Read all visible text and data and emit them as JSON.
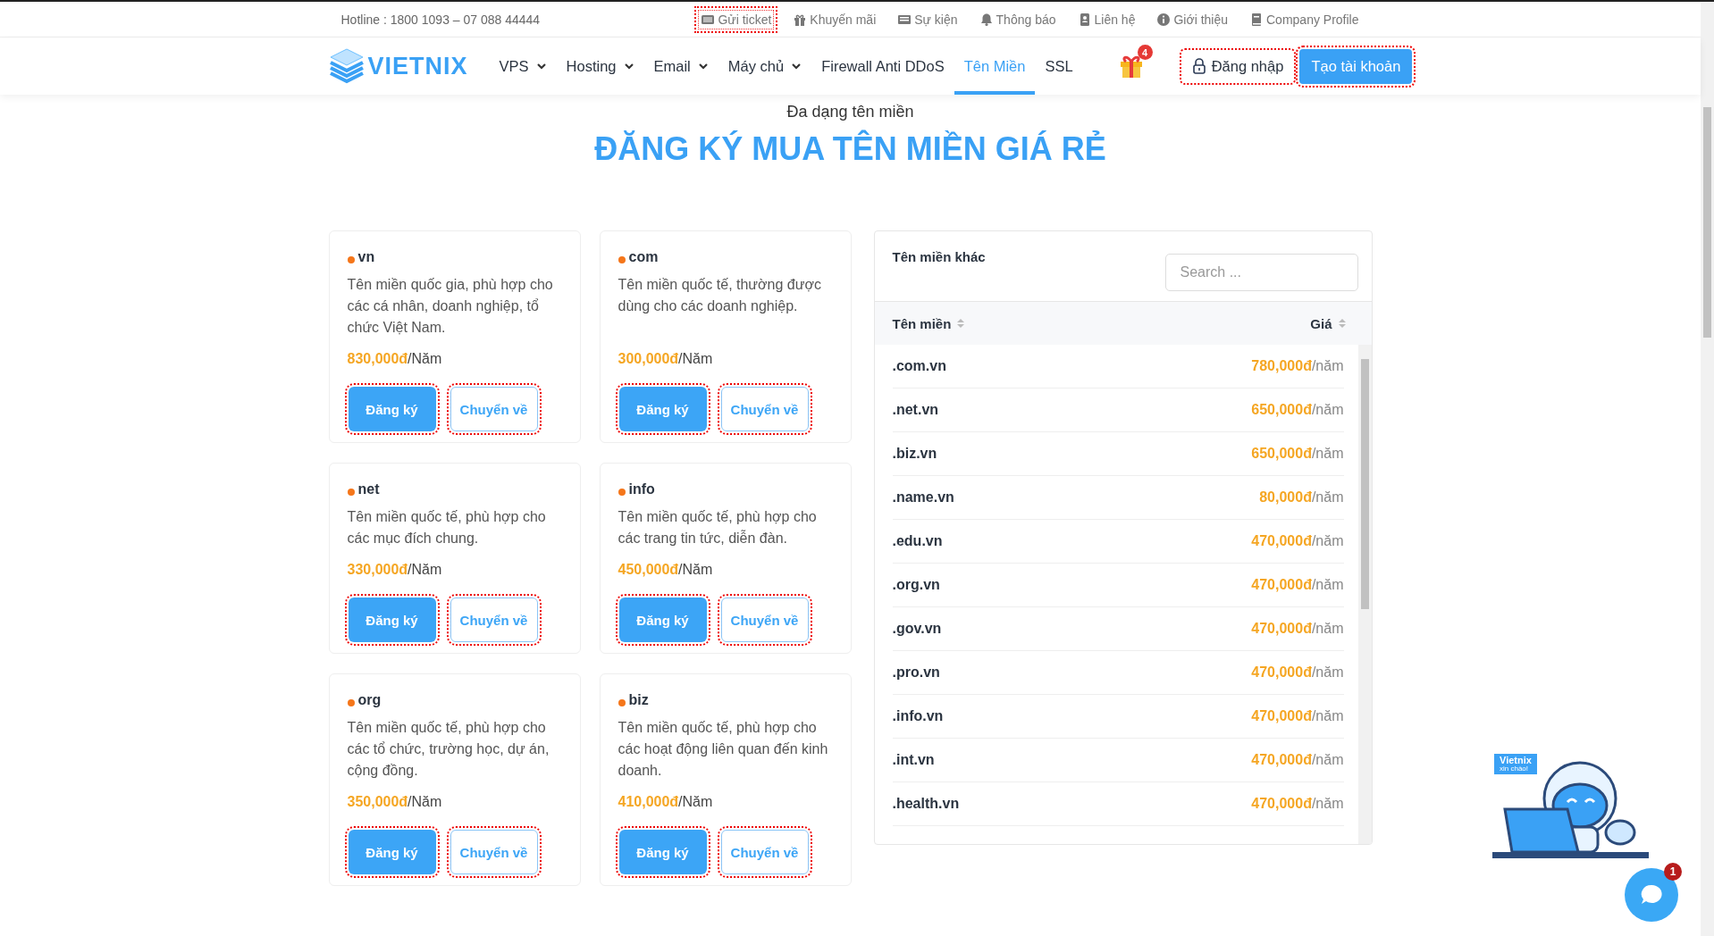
{
  "topbar": {
    "hotline": "Hotline : 1800 1093 – 07 088 44444",
    "links": [
      {
        "label": "Gửi ticket",
        "outlined": true
      },
      {
        "label": "Khuyến mãi",
        "outlined": false
      },
      {
        "label": "Sự kiện",
        "outlined": false
      },
      {
        "label": "Thông báo",
        "outlined": false
      },
      {
        "label": "Liên hệ",
        "outlined": false
      },
      {
        "label": "Giới thiệu",
        "outlined": false
      },
      {
        "label": "Company Profile",
        "outlined": false
      }
    ]
  },
  "nav": {
    "logo": "VIETNIX",
    "items": [
      {
        "label": "VPS",
        "dropdown": true,
        "selected": false
      },
      {
        "label": "Hosting",
        "dropdown": true,
        "selected": false
      },
      {
        "label": "Email",
        "dropdown": true,
        "selected": false
      },
      {
        "label": "Máy chủ",
        "dropdown": true,
        "selected": false
      },
      {
        "label": "Firewall Anti DDoS",
        "dropdown": false,
        "selected": false
      },
      {
        "label": "Tên Miền",
        "dropdown": false,
        "selected": true
      },
      {
        "label": "SSL",
        "dropdown": false,
        "selected": false
      }
    ],
    "gift_badge": "4",
    "login": {
      "label": "Đăng nhập",
      "outlined": true
    },
    "register": {
      "label": "Tạo tài khoản",
      "outlined": true
    }
  },
  "section": {
    "subtitle": "Đa dạng tên miền",
    "title": "ĐĂNG KÝ MUA TÊN MIỀN GIÁ RẺ"
  },
  "cards": [
    {
      "name": "vn",
      "description": "Tên miền quốc gia, phù hợp cho các cá nhân, doanh nghiệp, tổ chức Việt Nam.",
      "price": "830,000đ",
      "unit": "/Năm",
      "buttons": [
        {
          "label": "Đăng ký",
          "kind": "primary",
          "outlined": true
        },
        {
          "label": "Chuyển về",
          "kind": "secondary",
          "outlined": true
        }
      ]
    },
    {
      "name": "com",
      "description": "Tên miền quốc tế, thường được dùng cho các doanh nghiệp.",
      "price": "300,000đ",
      "unit": "/Năm",
      "buttons": [
        {
          "label": "Đăng ký",
          "kind": "primary",
          "outlined": true
        },
        {
          "label": "Chuyển về",
          "kind": "secondary",
          "outlined": true
        }
      ]
    },
    {
      "name": "net",
      "description": "Tên miền quốc tế, phù hợp cho các mục đích chung.",
      "price": "330,000đ",
      "unit": "/Năm",
      "buttons": [
        {
          "label": "Đăng ký",
          "kind": "primary",
          "outlined": true
        },
        {
          "label": "Chuyển về",
          "kind": "secondary",
          "outlined": true
        }
      ]
    },
    {
      "name": "info",
      "description": "Tên miền quốc tế, phù hợp cho các trang tin tức, diễn đàn.",
      "price": "450,000đ",
      "unit": "/Năm",
      "buttons": [
        {
          "label": "Đăng ký",
          "kind": "primary",
          "outlined": true
        },
        {
          "label": "Chuyển về",
          "kind": "secondary",
          "outlined": true
        }
      ]
    },
    {
      "name": "org",
      "description": "Tên miền quốc tế, phù hợp cho các tổ chức, trường học, dự án, cộng đồng.",
      "price": "350,000đ",
      "unit": "/Năm",
      "buttons": [
        {
          "label": "Đăng ký",
          "kind": "primary",
          "outlined": true
        },
        {
          "label": "Chuyển về",
          "kind": "secondary",
          "outlined": true
        }
      ]
    },
    {
      "name": "biz",
      "description": "Tên miền quốc tế, phù hợp cho các hoạt động liên quan đến kinh doanh.",
      "price": "410,000đ",
      "unit": "/Năm",
      "buttons": [
        {
          "label": "Đăng ký",
          "kind": "primary",
          "outlined": true
        },
        {
          "label": "Chuyển về",
          "kind": "secondary",
          "outlined": true
        }
      ]
    }
  ],
  "panel": {
    "title": "Tên miền khác",
    "search": {
      "placeholder": "Search ..."
    },
    "columns": [
      {
        "label": "Tên miền"
      },
      {
        "label": "Giá"
      }
    ],
    "rows": [
      {
        "domain": ".com.vn",
        "price": "780,000đ",
        "unit": "/năm"
      },
      {
        "domain": ".net.vn",
        "price": "650,000đ",
        "unit": "/năm"
      },
      {
        "domain": ".biz.vn",
        "price": "650,000đ",
        "unit": "/năm"
      },
      {
        "domain": ".name.vn",
        "price": "80,000đ",
        "unit": "/năm"
      },
      {
        "domain": ".edu.vn",
        "price": "470,000đ",
        "unit": "/năm"
      },
      {
        "domain": ".org.vn",
        "price": "470,000đ",
        "unit": "/năm"
      },
      {
        "domain": ".gov.vn",
        "price": "470,000đ",
        "unit": "/năm"
      },
      {
        "domain": ".pro.vn",
        "price": "470,000đ",
        "unit": "/năm"
      },
      {
        "domain": ".info.vn",
        "price": "470,000đ",
        "unit": "/năm"
      },
      {
        "domain": ".int.vn",
        "price": "470,000đ",
        "unit": "/năm"
      },
      {
        "domain": ".health.vn",
        "price": "470,000đ",
        "unit": "/năm"
      }
    ]
  },
  "chat": {
    "bubble_title": "Vietnix",
    "bubble_text": "xin chào!",
    "badge": "1"
  }
}
